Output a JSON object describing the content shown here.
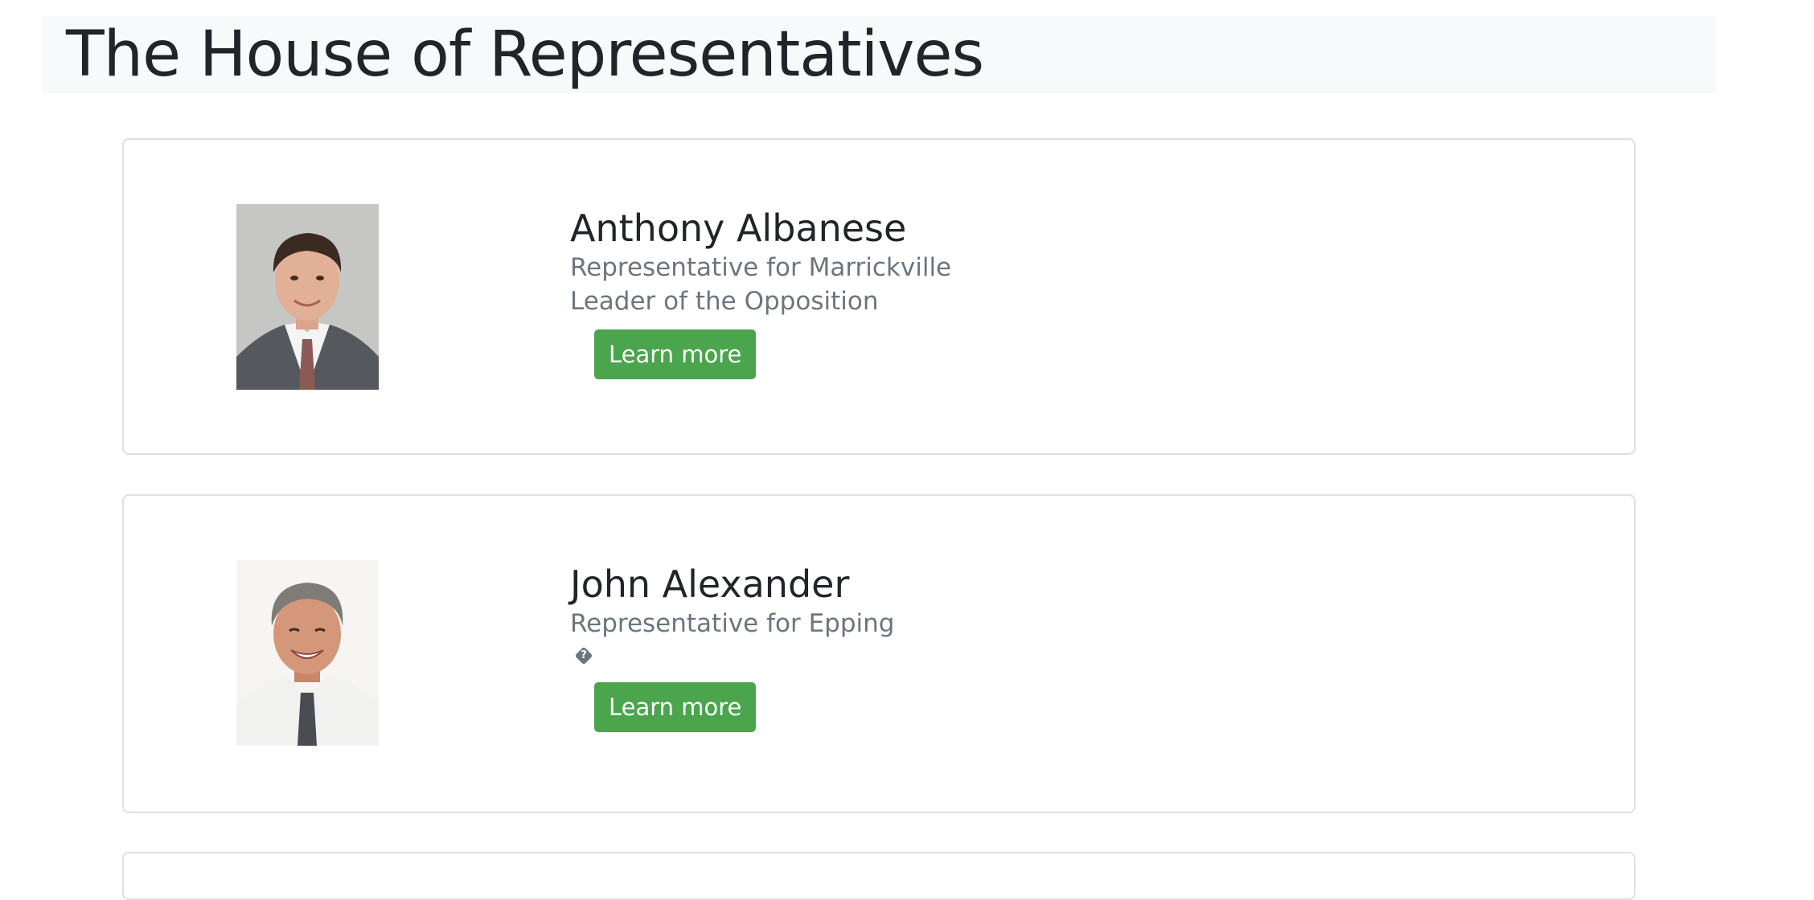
{
  "page": {
    "title": "The House of Representatives"
  },
  "representatives": [
    {
      "name": "Anthony Albanese",
      "electorate": "Representative for Marrickville",
      "position": "Leader of the Opposition",
      "button_label": "Learn more"
    },
    {
      "name": "John Alexander",
      "electorate": "Representative for Epping",
      "position_icon": "question-diamond-icon",
      "button_label": "Learn more"
    }
  ],
  "colors": {
    "button": "#4aa54c",
    "subtext": "#6c757d",
    "header_bg": "#f8f9fa",
    "card_border": "#dfdfdf"
  }
}
